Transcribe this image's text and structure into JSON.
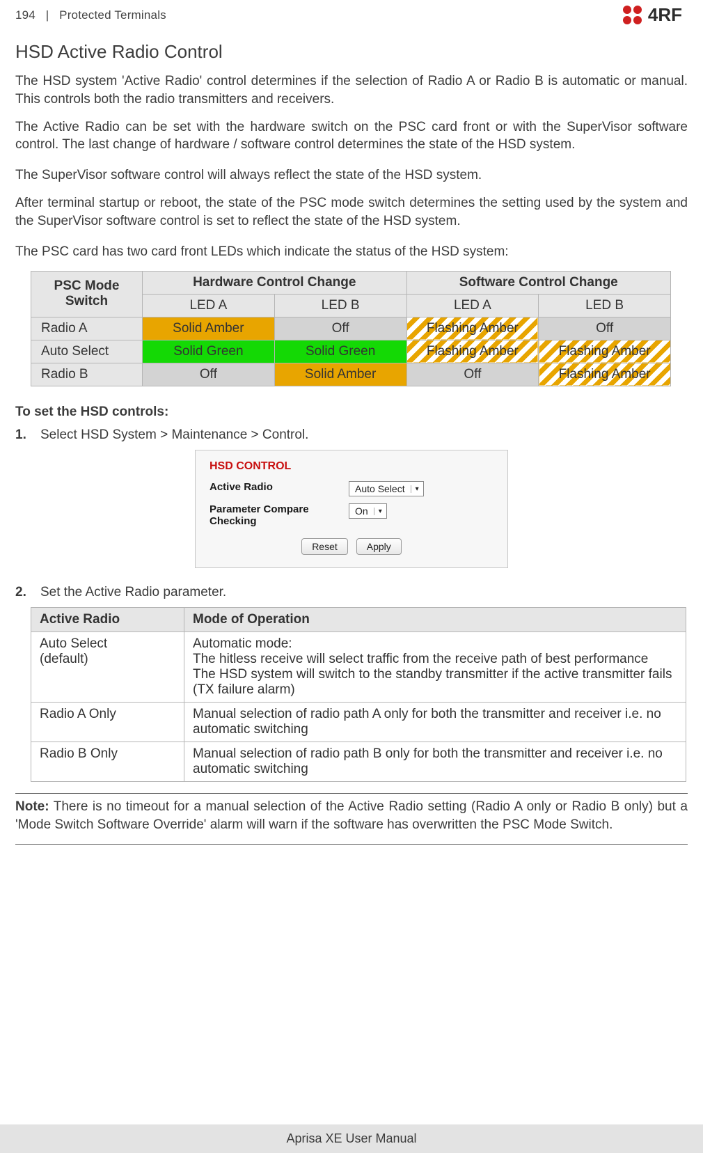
{
  "header": {
    "page_number": "194",
    "section": "Protected Terminals",
    "brand": "4RF"
  },
  "title": "HSD Active Radio Control",
  "paragraphs": {
    "p1": "The HSD system 'Active Radio' control determines if the selection of Radio A or Radio B is automatic or manual. This controls both the radio transmitters and receivers.",
    "p2": "The Active Radio can be set with the hardware switch on the PSC card front or with the SuperVisor software control. The last change of hardware / software control determines the state of the HSD system.",
    "p3": "The SuperVisor software control will always reflect the state of the HSD system.",
    "p4": "After terminal startup or reboot, the state of the PSC mode switch determines the setting used by the system and the SuperVisor software control is set to reflect the state of the HSD system.",
    "p5": "The PSC card has two card front LEDs which indicate the status of the HSD system:"
  },
  "led_table": {
    "h_psc": "PSC Mode Switch",
    "h_hw": "Hardware Control Change",
    "h_sw": "Software Control Change",
    "sub_a": "LED A",
    "sub_b": "LED B",
    "rows": [
      {
        "label": "Radio A",
        "cells": [
          "Solid Amber",
          "Off",
          "Flashing Amber",
          "Off"
        ]
      },
      {
        "label": "Auto Select",
        "cells": [
          "Solid Green",
          "Solid Green",
          "Flashing Amber",
          "Flashing Amber"
        ]
      },
      {
        "label": "Radio B",
        "cells": [
          "Off",
          "Solid Amber",
          "Off",
          "Flashing Amber"
        ]
      }
    ]
  },
  "steps_heading": "To set the HSD controls:",
  "step1": {
    "num": "1.",
    "text": "Select HSD System > Maintenance > Control."
  },
  "panel": {
    "title": "HSD CONTROL",
    "row1_label": "Active Radio",
    "row1_value": "Auto Select",
    "row2_label": "Parameter Compare Checking",
    "row2_value": "On",
    "reset": "Reset",
    "apply": "Apply"
  },
  "step2": {
    "num": "2.",
    "text": "Set the Active Radio parameter."
  },
  "mode_table": {
    "h1": "Active Radio",
    "h2": "Mode of Operation",
    "rows": [
      {
        "c1": "Auto Select\n(default)",
        "c2": "Automatic mode:\nThe hitless receive will select traffic from the receive path of best performance\nThe HSD system will switch to the standby transmitter if the active transmitter fails (TX failure alarm)"
      },
      {
        "c1": "Radio A Only",
        "c2": "Manual selection of radio path A only for both the transmitter and receiver i.e. no automatic switching"
      },
      {
        "c1": "Radio B Only",
        "c2": "Manual selection of radio path B only for both the transmitter and receiver i.e. no automatic switching"
      }
    ]
  },
  "note": "Note: There is no timeout for a manual selection of the Active Radio setting (Radio A only or Radio B only) but a 'Mode Switch Software Override' alarm will warn if the software has overwritten the PSC Mode Switch.",
  "note_prefix": "Note:",
  "footer": "Aprisa XE User Manual"
}
